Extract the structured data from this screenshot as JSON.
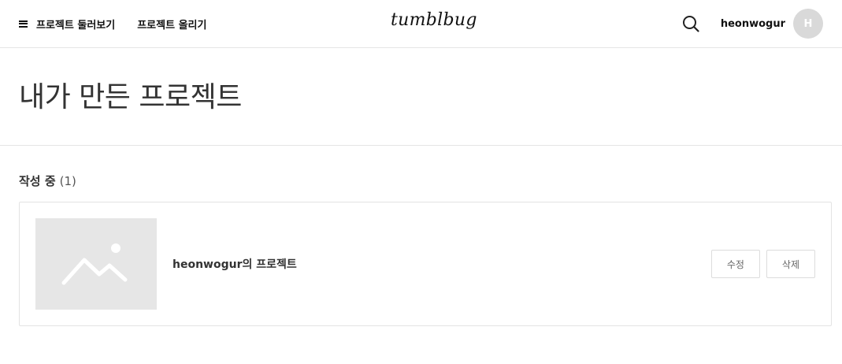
{
  "header": {
    "browse_label": "프로젝트 둘러보기",
    "upload_label": "프로젝트 올리기",
    "logo_text": "tumblbug",
    "username": "heonwogur",
    "avatar_initial": "H",
    "icons": [
      "menu-icon",
      "search-icon"
    ]
  },
  "page": {
    "title": "내가 만든 프로젝트"
  },
  "section": {
    "label": "작성 중",
    "count": "(1)"
  },
  "projects": [
    {
      "name": "heonwogur의 프로젝트",
      "thumbnail_icon": "image-placeholder-icon",
      "edit_label": "수정",
      "delete_label": "삭제"
    }
  ],
  "colors": {
    "text_primary": "#111111",
    "placeholder_bg": "#e6e6e6",
    "avatar_bg": "#d9d9d9",
    "border": "#e5e5e5"
  }
}
